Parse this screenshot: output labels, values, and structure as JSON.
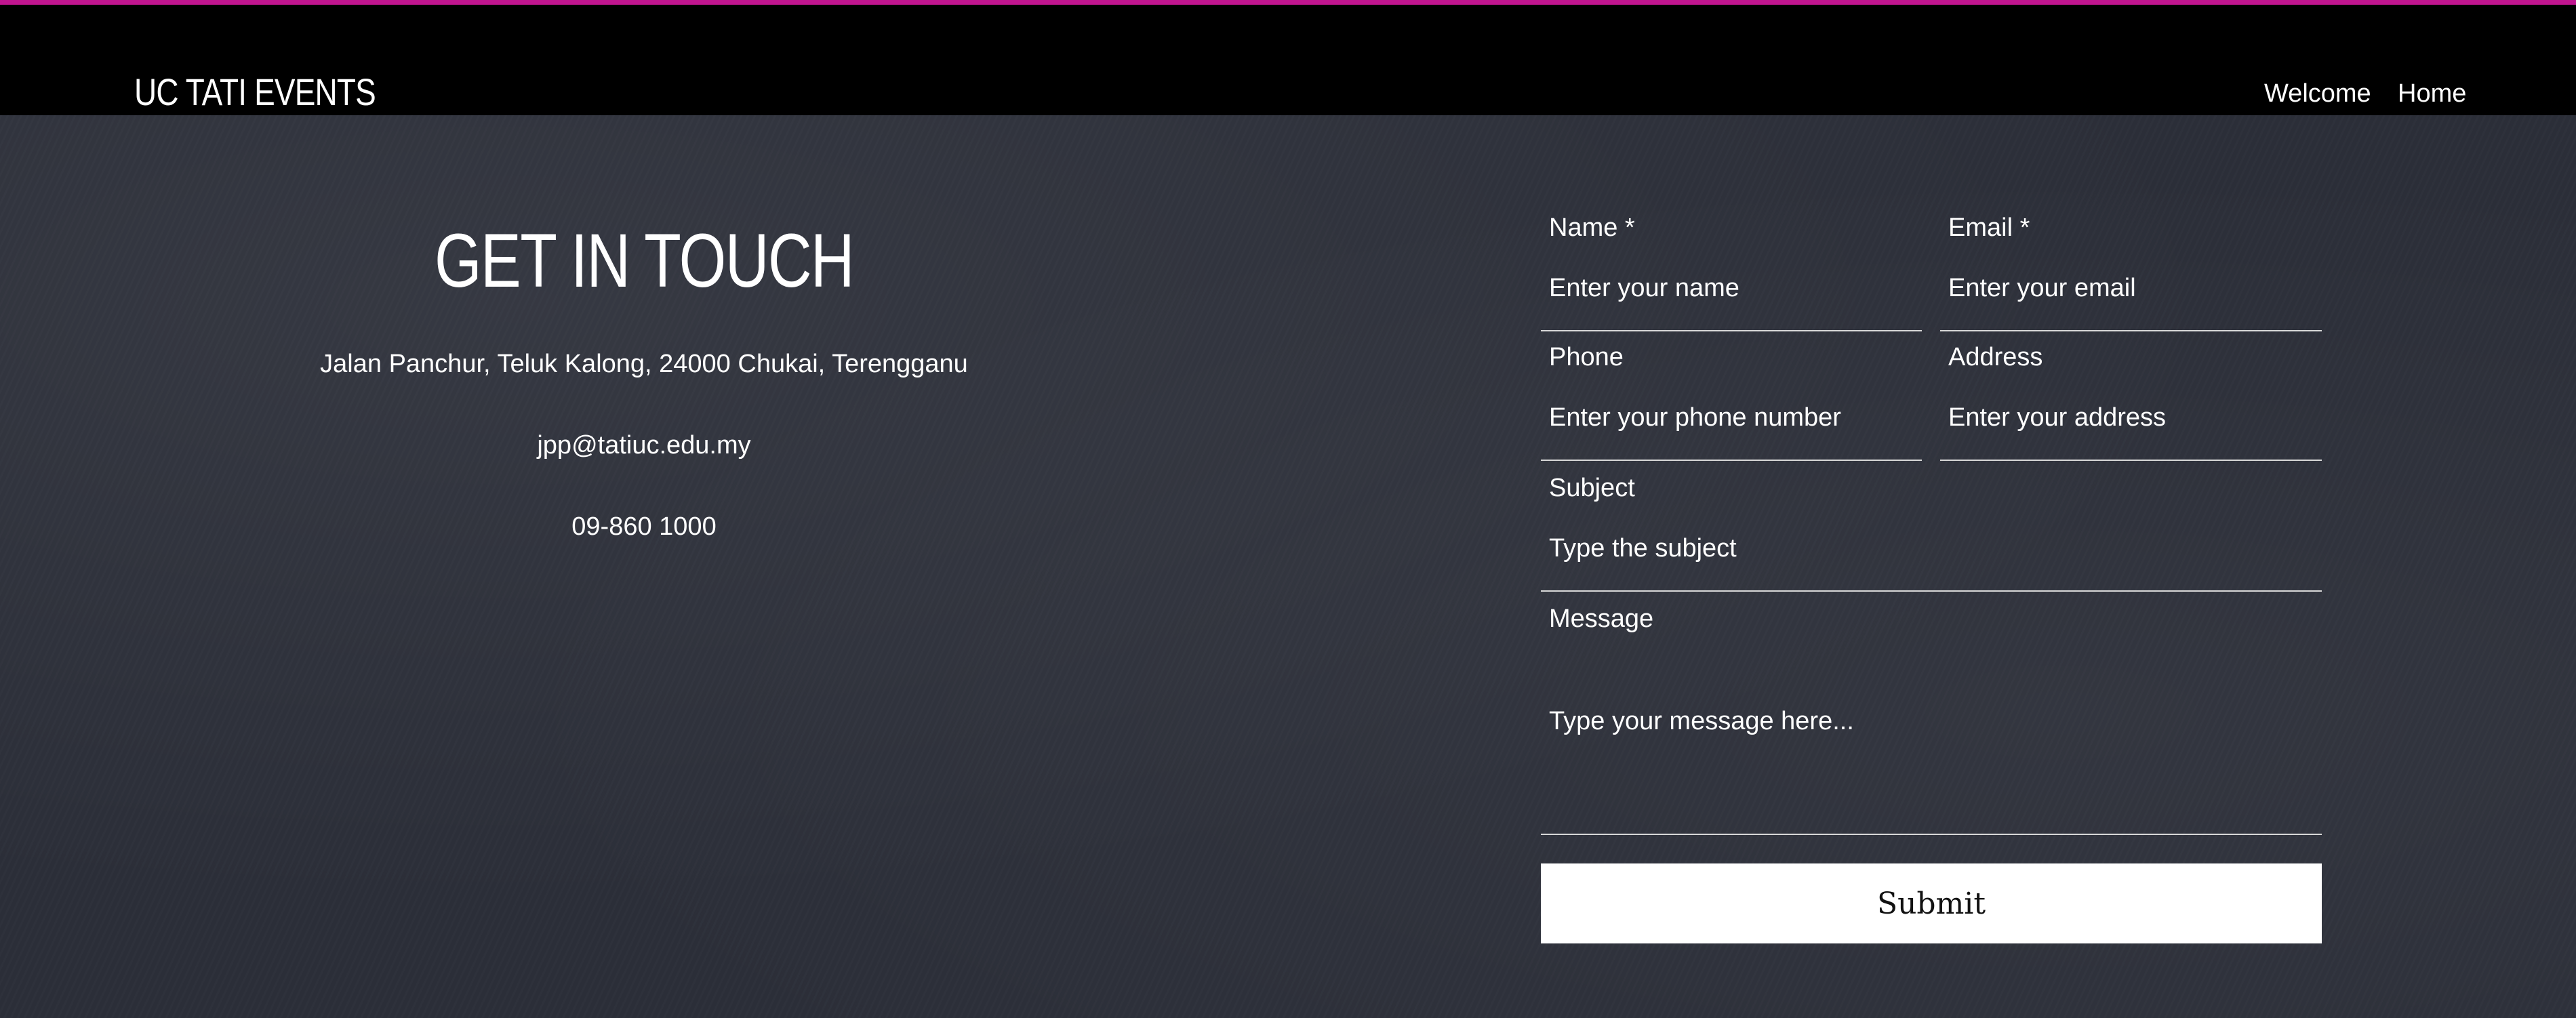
{
  "colors": {
    "accent": "#c0158f",
    "topbar": "#000000",
    "background": "#2c2f39"
  },
  "header": {
    "brand": "UC TATI EVENTS",
    "nav": [
      "Welcome",
      "Home"
    ]
  },
  "contact": {
    "title": "GET IN TOUCH",
    "address": "Jalan Panchur, Teluk Kalong, 24000 Chukai, Terengganu",
    "email": "jpp@tatiuc.edu.my",
    "phone": "09-860 1000"
  },
  "form": {
    "name": {
      "label": "Name *",
      "placeholder": "Enter your name"
    },
    "email": {
      "label": "Email *",
      "placeholder": "Enter your email"
    },
    "phone": {
      "label": "Phone",
      "placeholder": "Enter your phone number"
    },
    "address": {
      "label": "Address",
      "placeholder": "Enter your address"
    },
    "subject": {
      "label": "Subject",
      "placeholder": "Type the subject"
    },
    "message": {
      "label": "Message",
      "placeholder": "Type your message here..."
    },
    "submit_label": "Submit"
  }
}
